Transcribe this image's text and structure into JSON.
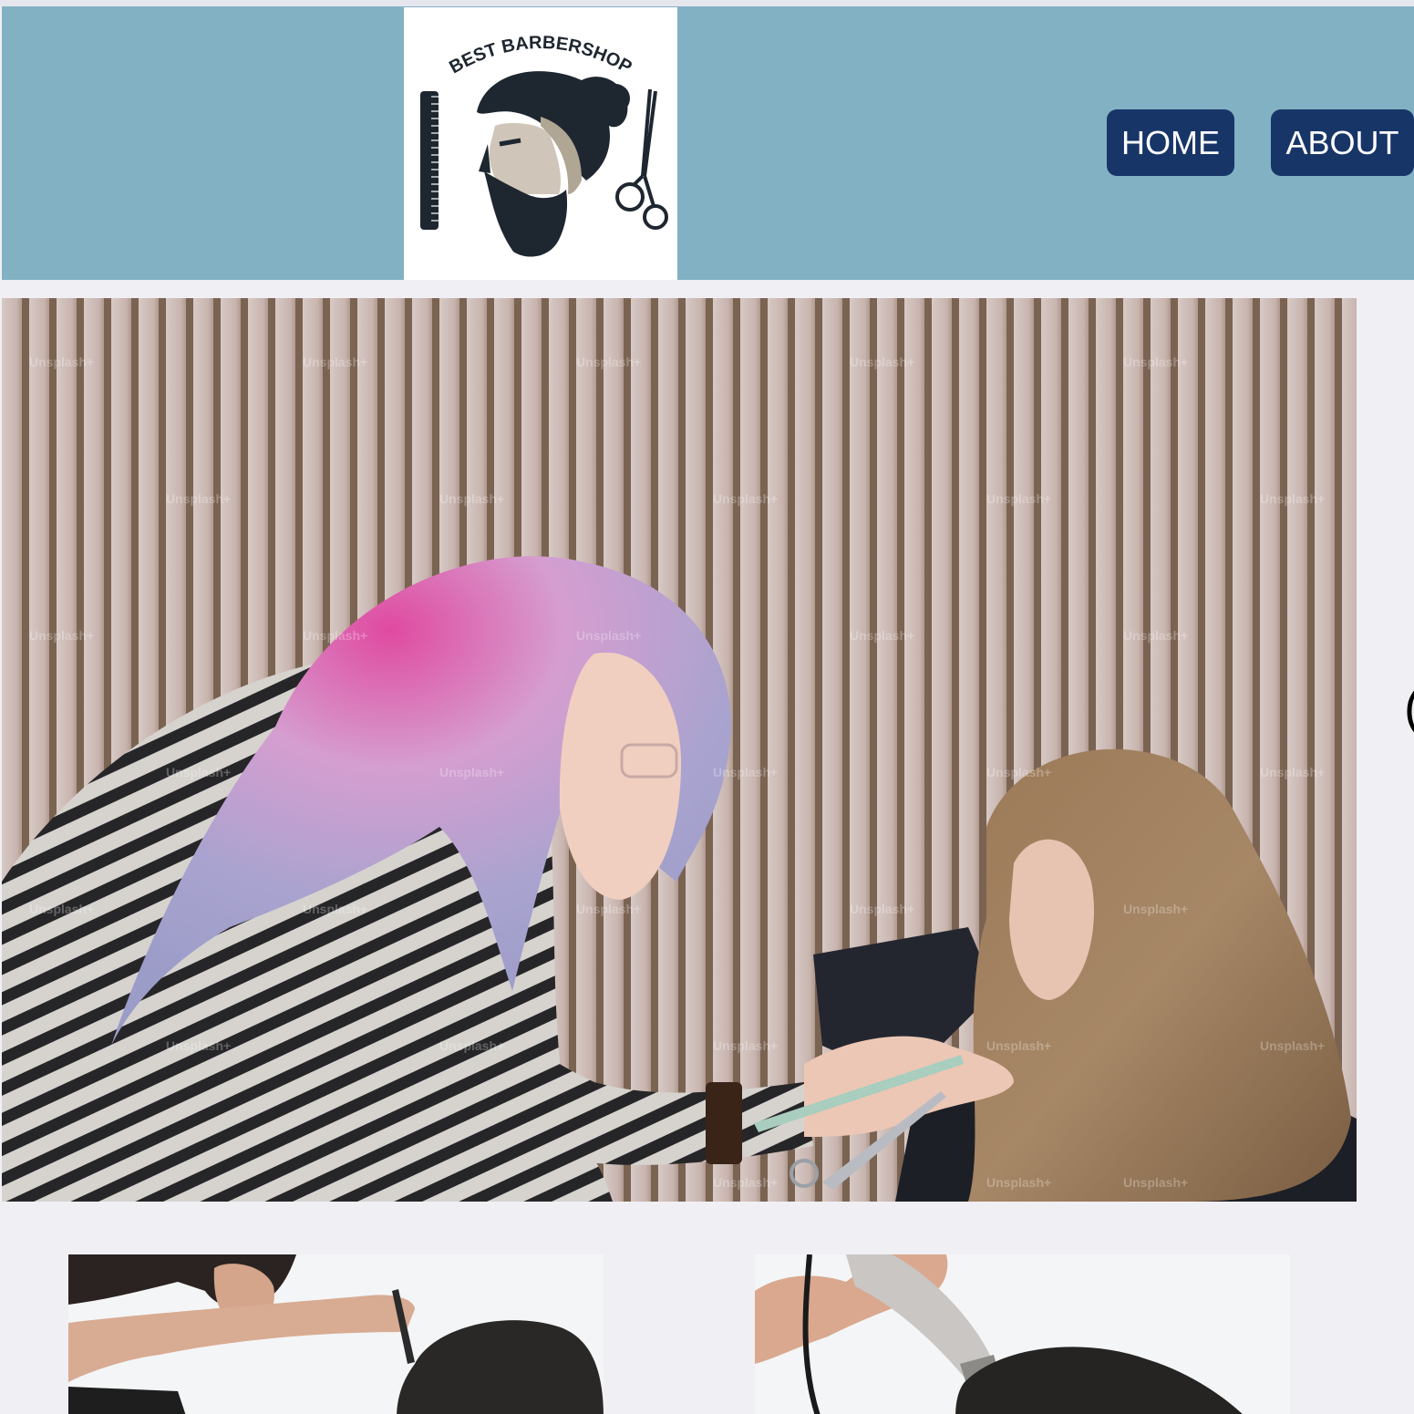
{
  "header": {
    "logo": {
      "text": "BEST BARBERSHOP",
      "icon": "barber-logo-icon"
    },
    "nav": [
      {
        "label": "HOME"
      },
      {
        "label": "ABOUT"
      }
    ]
  },
  "hero": {
    "image": "hair-stylist-photo",
    "watermark": "Unsplash+"
  },
  "gallery": {
    "images": [
      "haircut-scissors-photo",
      "haircut-clipper-photo"
    ]
  },
  "edge_glyph": "(",
  "colors": {
    "header_bg": "#82b1c4",
    "nav_button_bg": "#183568",
    "nav_button_text": "#ffffff",
    "page_bg": "#f0eff4"
  }
}
